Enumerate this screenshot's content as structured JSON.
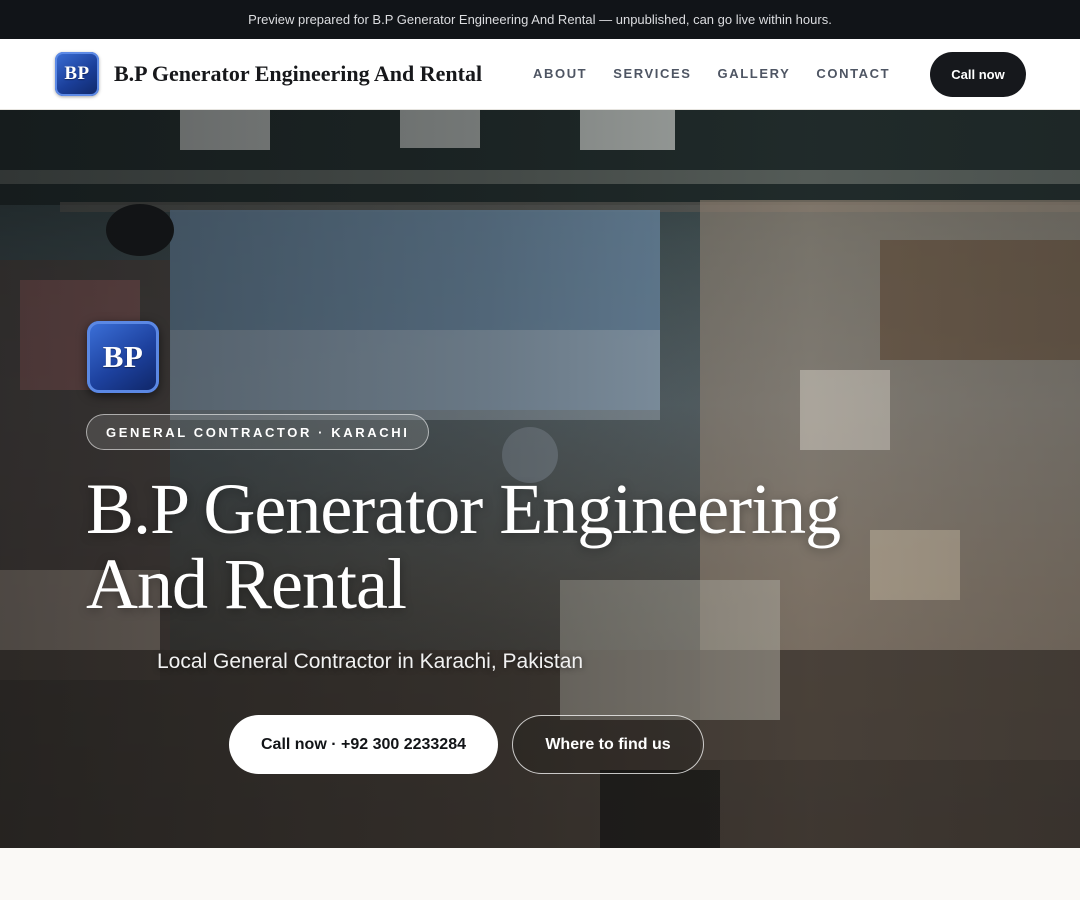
{
  "topbar": {
    "notice": "Preview prepared for B.P Generator Engineering And Rental — unpublished, can go live within hours."
  },
  "navbar": {
    "logo_text": "BP",
    "brand_name": "B.P Generator Engineering And Rental",
    "links": [
      {
        "label": "ABOUT"
      },
      {
        "label": "SERVICES"
      },
      {
        "label": "GALLERY"
      },
      {
        "label": "CONTACT"
      }
    ],
    "cta_label": "Call now"
  },
  "hero": {
    "logo_text": "BP",
    "badge": "GENERAL CONTRACTOR · KARACHI",
    "title": "B.P Generator Engineering And Rental",
    "subtitle": "Local General Contractor in Karachi, Pakistan",
    "primary_button": "Call now · +92 300 2233284",
    "secondary_button": "Where to find us"
  },
  "colors": {
    "topbar_bg": "#111418",
    "cta_dark": "#16181c",
    "logo_blue": "#1b3f9a",
    "page_bg": "#faf9f6"
  }
}
